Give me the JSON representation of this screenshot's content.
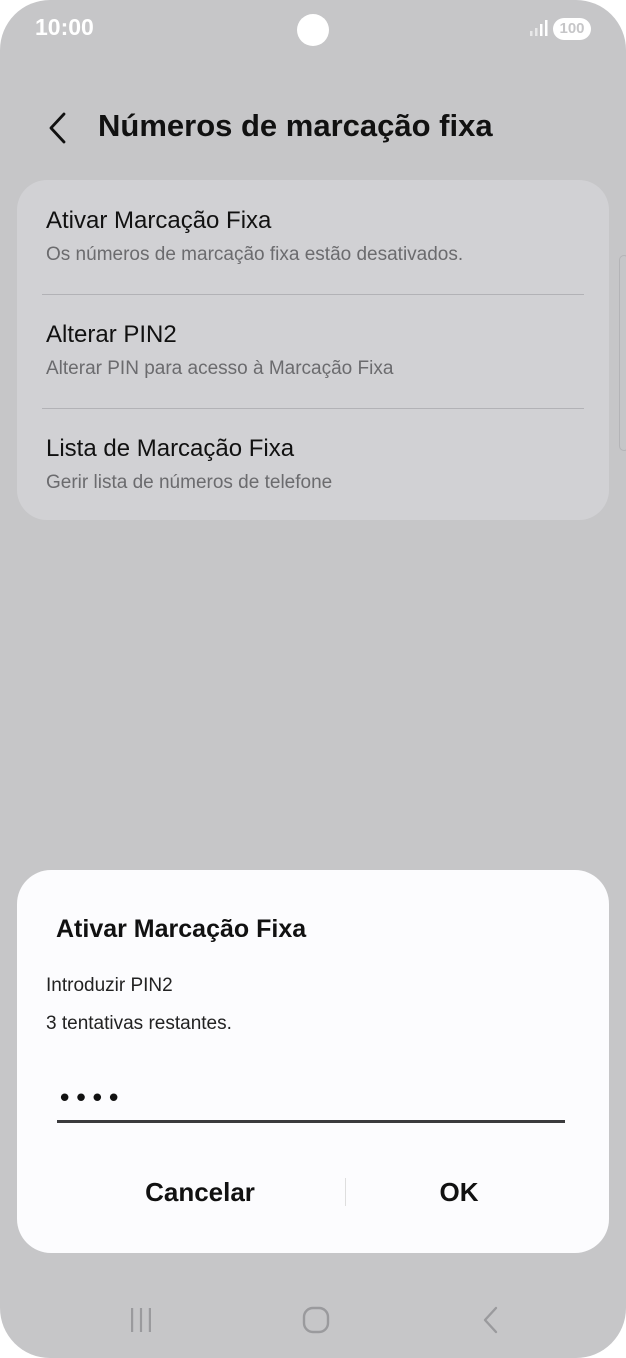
{
  "status_bar": {
    "time": "10:00",
    "battery": "100",
    "icons": [
      "signal-icon",
      "battery-icon"
    ],
    "icon_color": "#ffffff"
  },
  "header": {
    "title": "Números de marcação fixa",
    "back_icon": "chevron-left-icon"
  },
  "settings": {
    "items": [
      {
        "title": "Ativar Marcação Fixa",
        "subtitle": "Os números de marcação fixa estão desativados."
      },
      {
        "title": "Alterar PIN2",
        "subtitle": "Alterar PIN para acesso à Marcação Fixa"
      },
      {
        "title": "Lista de Marcação Fixa",
        "subtitle": "Gerir lista de números de telefone"
      }
    ]
  },
  "dialog": {
    "title": "Ativar Marcação Fixa",
    "message": "Introduzir PIN2",
    "attempts": "3 tentativas restantes.",
    "pin_value": "••••",
    "cancel_label": "Cancelar",
    "ok_label": "OK"
  },
  "nav_bar": {
    "icons": [
      "recent-apps-icon",
      "home-icon",
      "back-icon"
    ]
  },
  "colors": {
    "background_dim": "#c6c6c8",
    "card": "#d1d1d4",
    "dialog": "#fcfcfe",
    "text_primary": "#111111",
    "text_secondary": "#6b6b6e"
  }
}
